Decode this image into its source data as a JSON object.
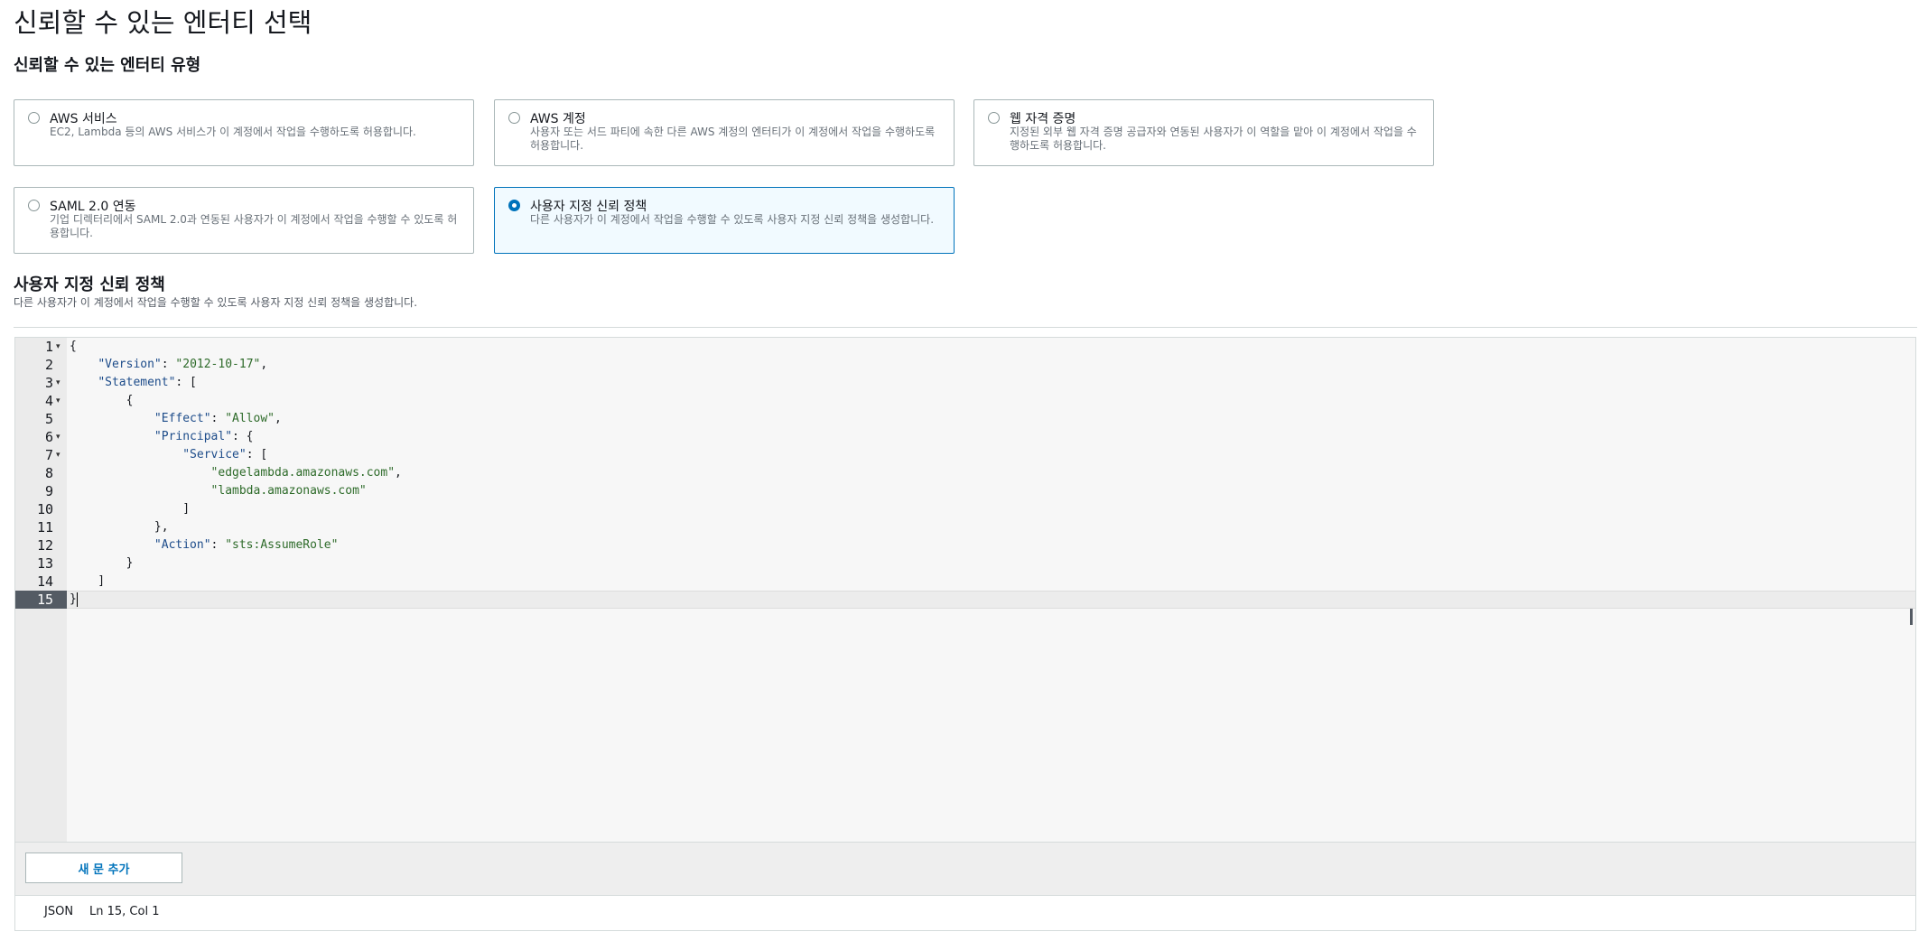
{
  "page_title": "신뢰할 수 있는 엔터티 선택",
  "entity_type_section": {
    "title": "신뢰할 수 있는 엔터티 유형"
  },
  "entity_types": [
    {
      "title": "AWS 서비스",
      "description": "EC2, Lambda 등의 AWS 서비스가 이 계정에서 작업을 수행하도록 허용합니다.",
      "selected": false
    },
    {
      "title": "AWS 계정",
      "description": "사용자 또는 서드 파티에 속한 다른 AWS 계정의 엔터티가 이 계정에서 작업을 수행하도록 허용합니다.",
      "selected": false
    },
    {
      "title": "웹 자격 증명",
      "description": "지정된 외부 웹 자격 증명 공급자와 연동된 사용자가 이 역할을 맡아 이 계정에서 작업을 수행하도록 허용합니다.",
      "selected": false
    },
    {
      "title": "SAML 2.0 연동",
      "description": "기업 디렉터리에서 SAML 2.0과 연동된 사용자가 이 계정에서 작업을 수행할 수 있도록 허용합니다.",
      "selected": false
    },
    {
      "title": "사용자 지정 신뢰 정책",
      "description": "다른 사용자가 이 계정에서 작업을 수행할 수 있도록 사용자 지정 신뢰 정책을 생성합니다.",
      "selected": true
    }
  ],
  "custom_policy": {
    "title": "사용자 지정 신뢰 정책",
    "description": "다른 사용자가 이 계정에서 작업을 수행할 수 있도록 사용자 지정 신뢰 정책을 생성합니다."
  },
  "editor": {
    "lines": [
      {
        "n": "1",
        "fold": true,
        "tokens": [
          [
            "p",
            "{"
          ]
        ]
      },
      {
        "n": "2",
        "fold": false,
        "tokens": [
          [
            "p",
            "    "
          ],
          [
            "k",
            "\"Version\""
          ],
          [
            "p",
            ": "
          ],
          [
            "s",
            "\"2012-10-17\""
          ],
          [
            "p",
            ","
          ]
        ]
      },
      {
        "n": "3",
        "fold": true,
        "tokens": [
          [
            "p",
            "    "
          ],
          [
            "k",
            "\"Statement\""
          ],
          [
            "p",
            ": ["
          ]
        ]
      },
      {
        "n": "4",
        "fold": true,
        "tokens": [
          [
            "p",
            "        {"
          ]
        ]
      },
      {
        "n": "5",
        "fold": false,
        "tokens": [
          [
            "p",
            "            "
          ],
          [
            "k",
            "\"Effect\""
          ],
          [
            "p",
            ": "
          ],
          [
            "s",
            "\"Allow\""
          ],
          [
            "p",
            ","
          ]
        ]
      },
      {
        "n": "6",
        "fold": true,
        "tokens": [
          [
            "p",
            "            "
          ],
          [
            "k",
            "\"Principal\""
          ],
          [
            "p",
            ": {"
          ]
        ]
      },
      {
        "n": "7",
        "fold": true,
        "tokens": [
          [
            "p",
            "                "
          ],
          [
            "k",
            "\"Service\""
          ],
          [
            "p",
            ": ["
          ]
        ]
      },
      {
        "n": "8",
        "fold": false,
        "tokens": [
          [
            "p",
            "                    "
          ],
          [
            "s",
            "\"edgelambda.amazonaws.com\""
          ],
          [
            "p",
            ","
          ]
        ]
      },
      {
        "n": "9",
        "fold": false,
        "tokens": [
          [
            "p",
            "                    "
          ],
          [
            "s",
            "\"lambda.amazonaws.com\""
          ]
        ]
      },
      {
        "n": "10",
        "fold": false,
        "tokens": [
          [
            "p",
            "                ]"
          ]
        ]
      },
      {
        "n": "11",
        "fold": false,
        "tokens": [
          [
            "p",
            "            },"
          ]
        ]
      },
      {
        "n": "12",
        "fold": false,
        "tokens": [
          [
            "p",
            "            "
          ],
          [
            "k",
            "\"Action\""
          ],
          [
            "p",
            ": "
          ],
          [
            "s",
            "\"sts:AssumeRole\""
          ]
        ]
      },
      {
        "n": "13",
        "fold": false,
        "tokens": [
          [
            "p",
            "        }"
          ]
        ]
      },
      {
        "n": "14",
        "fold": false,
        "tokens": [
          [
            "p",
            "    ]"
          ]
        ]
      },
      {
        "n": "15",
        "fold": false,
        "tokens": [
          [
            "p",
            "}"
          ]
        ],
        "active": true
      }
    ],
    "add_statement_label": "새 문 추가",
    "status": {
      "mode": "JSON",
      "position": "Ln 15, Col 1"
    }
  },
  "colors": {
    "accent": "#0073bb",
    "selected_bg": "#f1faff",
    "gutter_active": "#545b64"
  }
}
